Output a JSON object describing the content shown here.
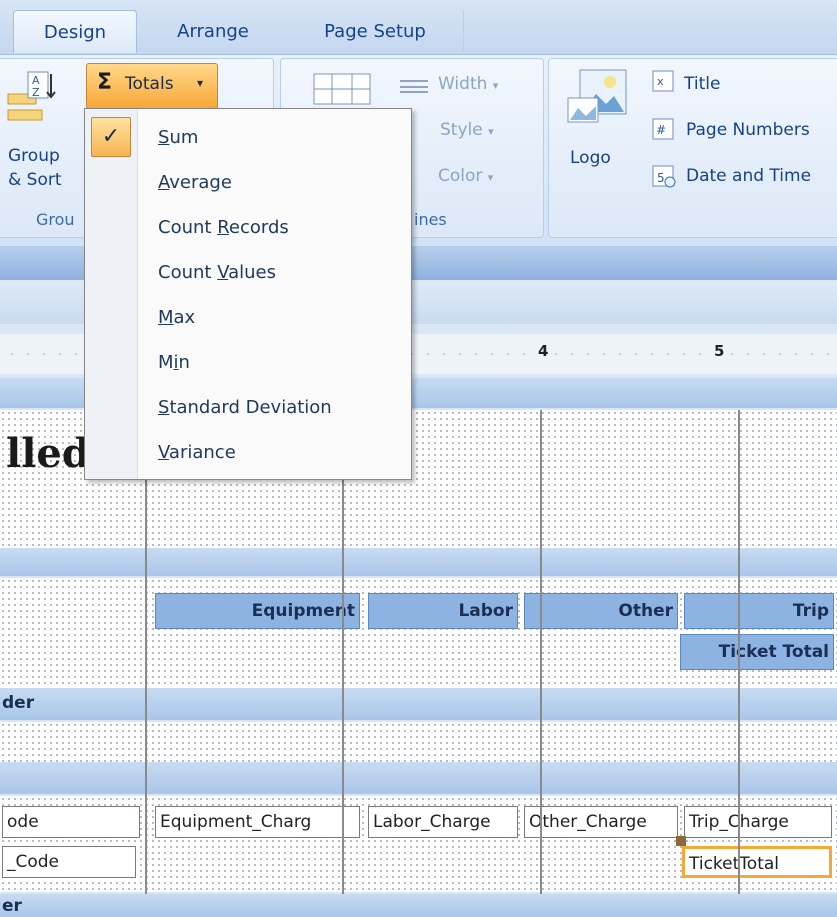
{
  "ribbon": {
    "tabs": [
      {
        "label": "Design",
        "active": true
      },
      {
        "label": "Arrange",
        "active": false
      },
      {
        "label": "Page Setup",
        "active": false
      }
    ],
    "group_sort": {
      "button_label_1": "Group",
      "button_label_2": "& Sort",
      "group_label": "Grou"
    },
    "totals_label": "Totals",
    "gridlines": {
      "width_label": "Width",
      "style_label": "Style",
      "color_label": "Color",
      "group_label": "ines"
    },
    "logo_label": "Logo",
    "header_controls": {
      "title_label": "Title",
      "page_numbers_label": "Page Numbers",
      "date_time_label": "Date and Time"
    }
  },
  "totals_menu": {
    "items": [
      {
        "label_pre": "",
        "accel": "S",
        "label_post": "um",
        "checked": true
      },
      {
        "label_pre": "",
        "accel": "A",
        "label_post": "verage",
        "checked": false
      },
      {
        "label_pre": "Count ",
        "accel": "R",
        "label_post": "ecords",
        "checked": false
      },
      {
        "label_pre": "Count ",
        "accel": "V",
        "label_post": "alues",
        "checked": false
      },
      {
        "label_pre": "",
        "accel": "M",
        "label_post": "ax",
        "checked": false
      },
      {
        "label_pre": "M",
        "accel": "i",
        "label_post": "n",
        "checked": false
      },
      {
        "label_pre": "",
        "accel": "S",
        "label_post": "tandard Deviation",
        "checked": false
      },
      {
        "label_pre": "",
        "accel": "V",
        "label_post": "ariance",
        "checked": false
      }
    ],
    "check_glyph": "✓"
  },
  "ruler": {
    "marks": [
      "4",
      "5"
    ]
  },
  "report": {
    "title_fragment": "lled",
    "column_headers": {
      "equipment": "Equipment",
      "labor": "Labor",
      "other": "Other",
      "trip": "Trip",
      "ticket_total": "Ticket Total"
    },
    "group_header_fragment": "der",
    "fields": {
      "code_1": "ode",
      "code_2": "_Code",
      "equipment": "Equipment_Charg",
      "labor": "Labor_Charge",
      "other": "Other_Charge",
      "trip": "Trip_Charge",
      "ticket_total": "TicketTotal"
    },
    "footer_fragment": "er"
  },
  "colors": {
    "accent_orange": "#f7a738",
    "header_blue": "#8db3e2",
    "ribbon_text": "#15428b"
  }
}
